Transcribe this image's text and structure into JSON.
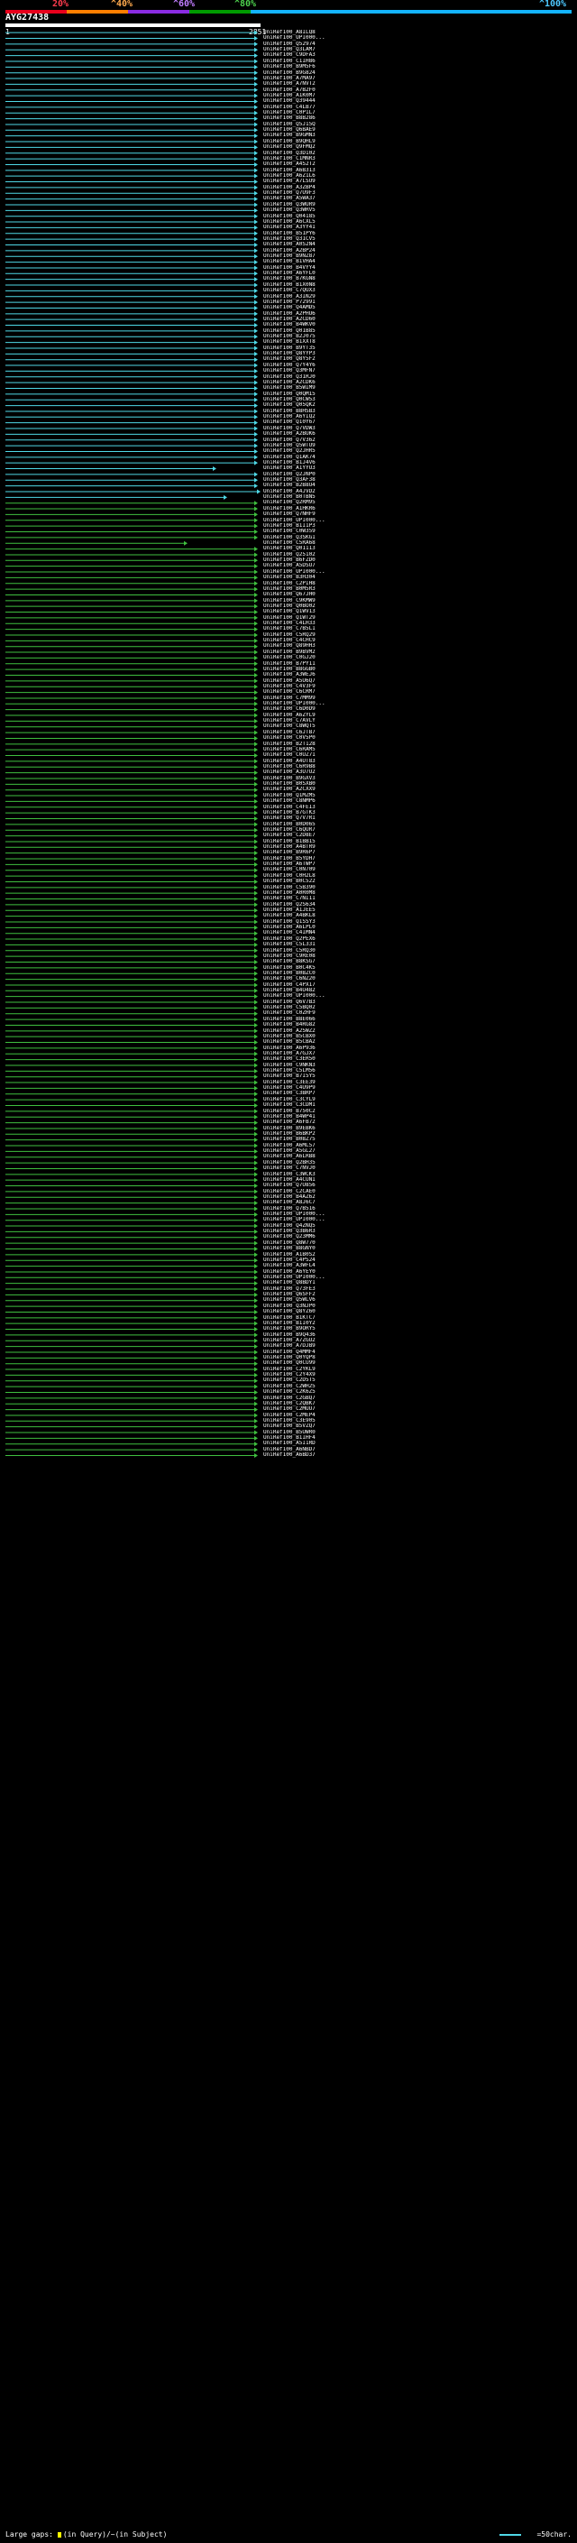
{
  "scale": {
    "labels": [
      "20%",
      "^40%",
      "^60%",
      "^80%",
      "^100%"
    ],
    "colors": [
      "#e8001c",
      "#ff7f00",
      "#8a2be2",
      "#009b00",
      "#14b4ff"
    ]
  },
  "query": {
    "id": "AYG27438",
    "start": "1",
    "end": "2851"
  },
  "hits": [
    "UniRef100_A8ILQ8",
    "UniRef100_UPI000...",
    "UniRef100_Q52974",
    "UniRef100_Q3LAM7",
    "UniRef100_C9DFA3",
    "UniRef100_C1IH86",
    "UniRef100_B9M5F6",
    "UniRef100_B9G824",
    "UniRef100_A7MA97",
    "UniRef100_A7NVT2",
    "UniRef100_A7B2F0",
    "UniRef100_A1K0M7",
    "UniRef100_Q39444",
    "UniRef100_C4LB77",
    "UniRef100_C0P1L7",
    "UniRef100_B8B286",
    "UniRef100_Q5J15Q",
    "UniRef100_Q6BAE9",
    "UniRef100_B9GMN3",
    "UniRef100_B9QHL9",
    "UniRef100_Q9FMQ2",
    "UniRef100_Q3D102",
    "UniRef100_C1MNR3",
    "UniRef100_A4S2T2",
    "UniRef100_A6B313",
    "UniRef100_A6Z1L6",
    "UniRef100_A7LSU9",
    "UniRef100_A3ZBP4",
    "UniRef100_Q7U9F3",
    "UniRef100_A5WA37",
    "UniRef100_Q3WUR9",
    "UniRef100_Q3WRV5",
    "UniRef100_Q04185",
    "UniRef100_A6CXL5",
    "UniRef100_A3YY41",
    "UniRef100_B51PY6",
    "UniRef100_Q31CV5",
    "UniRef100_A0S2N4",
    "UniRef100_A2BP24",
    "UniRef100_B9NZ87",
    "UniRef100_B1VHA4",
    "UniRef100_B4VYY4",
    "UniRef100_A6YFL0",
    "UniRef100_B7KGN8",
    "UniRef100_B1X0N8",
    "UniRef100_C7QUX3",
    "UniRef100_A3IN29",
    "UniRef100_P72991",
    "UniRef100_Q4AMD5",
    "UniRef100_A2PHU6",
    "UniRef100_A2CD60",
    "UniRef100_B4WKV0",
    "UniRef100_Q01B85",
    "UniRef100_B2J075",
    "UniRef100_B1XXT8",
    "UniRef100_B9YT35",
    "UniRef100_Q8YYP3",
    "UniRef100_Q8Y5F2",
    "UniRef100_Q7Y4Y6",
    "UniRef100_Q3MFN7",
    "UniRef100_Q31RJ0",
    "UniRef100_A2CDK6",
    "UniRef100_B5WIM9",
    "UniRef100_Q0QM15",
    "UniRef100_Q0CW53",
    "UniRef100_Q05QK2",
    "UniRef100_B8HSB3",
    "UniRef100_A6YIQ2",
    "UniRef100_Q10Y67",
    "UniRef100_Q7VDW3",
    "UniRef100_A2BUK6",
    "UniRef100_Q7V362",
    "UniRef100_Q5WTU9",
    "UniRef100_Q2JHR5",
    "UniRef100_Q1AK74",
    "UniRef100_B1J4V6",
    "UniRef100_A1YYU3",
    "UniRef100_Q2JNP0",
    "UniRef100_Q3AF38",
    "UniRef100_B2B8U4",
    "UniRef100_A4JVD2",
    "UniRef100_B0TBN5",
    "UniRef100_Q2RM95",
    "UniRef100_A1HKR6",
    "UniRef100_Q7NHF9",
    "UniRef100_UPI000...",
    "UniRef100_B1I1P3",
    "UniRef100_C0W359",
    "UniRef100_Q3SKG1",
    "UniRef100_C5RA68",
    "UniRef100_Q01113",
    "UniRef100_Q25102",
    "UniRef100_B6FZD0",
    "UniRef100_A5DSU7",
    "UniRef100_UPI000...",
    "UniRef100_B3H304",
    "UniRef100_C2PIH8",
    "UniRef100_B0M5R3",
    "UniRef100_Q67JH0",
    "UniRef100_C9KMW9",
    "UniRef100_Q0BO02",
    "UniRef100_Q1WV13",
    "UniRef100_Q1WT29",
    "UniRef100_C4LH33",
    "UniRef100_C7B5L1",
    "UniRef100_C5RQ29",
    "UniRef100_C4CHC9",
    "UniRef100_Q89HH3",
    "UniRef100_B9BVM2",
    "UniRef100_C0GJ20",
    "UniRef100_B7PY11",
    "UniRef100_B8GGB0",
    "UniRef100_A3WEJ6",
    "UniRef100_A5U6Q7",
    "UniRef100_C4V3F9",
    "UniRef100_C6CRM7",
    "UniRef100_C7MM99",
    "UniRef100_UPI000...",
    "UniRef100_C6D0D9",
    "UniRef100_A6ZYL9",
    "UniRef100_C7AVLY",
    "UniRef100_C8WQT5",
    "UniRef100_C6JTB7",
    "UniRef100_C0V5P0",
    "UniRef100_B2T128",
    "UniRef100_C6RAM5",
    "UniRef100_C0UZ71",
    "UniRef100_A4UT83",
    "UniRef100_C6R9B8",
    "UniRef100_A3U7U2",
    "UniRef100_B9GXV3",
    "UniRef100_B0SXB0",
    "UniRef100_A2CXX9",
    "UniRef100_Q1MZM5",
    "UniRef100_C8NMP6",
    "UniRef100_C4FEI3",
    "UniRef100_B7GTK3",
    "UniRef100_Q7V7R1",
    "UniRef100_B0D065",
    "UniRef100_C6QUR7",
    "UniRef100_C2D8E7",
    "UniRef100_B1BB15",
    "UniRef100_A4BTR9",
    "UniRef100_B9R6P7",
    "UniRef100_B5YDH7",
    "UniRef100_A6TWP7",
    "UniRef100_C0N709",
    "UniRef100_C0H2L8",
    "UniRef100_B0C522",
    "UniRef100_C5B390",
    "UniRef100_A0R0M8",
    "UniRef100_C7NI11",
    "UniRef100_Q2S634",
    "UniRef100_A1JEE5",
    "UniRef100_A4BKL8",
    "UniRef100_Q1SSY3",
    "UniRef100_A6LPL0",
    "UniRef100_C4IMN4",
    "UniRef100_Q2PEX6",
    "UniRef100_C5L331",
    "UniRef100_C5RQ30",
    "UniRef100_C9RE08",
    "UniRef100_B8KSG7",
    "UniRef100_B0C4K5",
    "UniRef100_B0BZC0",
    "UniRef100_C6NZ20",
    "UniRef100_C4PX17",
    "UniRef100_B4U482",
    "UniRef100_UPI000...",
    "UniRef100_Q6V7B3",
    "UniRef100_C5BQ02",
    "UniRef100_C0ZHF9",
    "UniRef100_B8E066",
    "UniRef100_B4RG82",
    "UniRef100_A2SWZ2",
    "UniRef100_B5CBX0",
    "UniRef100_B5CBA2",
    "UniRef100_A6P936",
    "UniRef100_A7GJX7",
    "UniRef100_C3ER50",
    "UniRef100_C9NKN3",
    "UniRef100_C5LM56",
    "UniRef100_B7I5Y5",
    "UniRef100_C3EE39",
    "UniRef100_C4U9P9",
    "UniRef100_C3BRP7",
    "UniRef100_C3CYL9",
    "UniRef100_C3CDM1",
    "UniRef100_B750C2",
    "UniRef100_B4WP41",
    "UniRef100_A6FB72",
    "UniRef100_B9EBK6",
    "UniRef100_B6BKP2",
    "UniRef100_B0BZ75",
    "UniRef100_A6ML57",
    "UniRef100_A5GL27",
    "UniRef100_A6LRB8",
    "UniRef100_Q2BH35",
    "UniRef100_C7NVJ0",
    "UniRef100_C3WCK3",
    "UniRef100_A4CUN1",
    "UniRef100_Q7U856",
    "UniRef100_C2CAE0",
    "UniRef100_B4AZ62",
    "UniRef100_A8J6C7",
    "UniRef100_Q7B516",
    "UniRef100_UPI000...",
    "UniRef100_UPI000...",
    "UniRef100_Q4ZNQ5",
    "UniRef100_Q3B6R3",
    "UniRef100_Q23MM6",
    "UniRef100_Q8W770",
    "UniRef100_B8GNY0",
    "UniRef100_A1B0S2",
    "UniRef100_C4PS24",
    "UniRef100_A3WFL4",
    "UniRef100_A6YEY0",
    "UniRef100_UPI000...",
    "UniRef100_Q8BDY1",
    "UniRef100_Q73FE3",
    "UniRef100_Q6SFF2",
    "UniRef100_Q5WLV6",
    "UniRef100_Q3NJP0",
    "UniRef100_Q8YZ60",
    "UniRef100_B1KTC7",
    "UniRef100_B1I0Y2",
    "UniRef100_B9ORY5",
    "UniRef100_B9Q436",
    "UniRef100_A7ZGU2",
    "UniRef100_A7DJB9",
    "UniRef100_Q4MMF4",
    "UniRef100_Q0YQP8",
    "UniRef100_Q0CU99",
    "UniRef100_C2YKL9",
    "UniRef100_C2Y4X9",
    "UniRef100_C2D5T5",
    "UniRef100_C2WH25",
    "UniRef100_C2K6Z5",
    "UniRef100_C2GBQ7",
    "UniRef100_C2QBK7",
    "UniRef100_C2MUU7",
    "UniRef100_C2MEP4",
    "UniRef100_C3E905",
    "UniRef100_B5VZQ7",
    "UniRef100_B5UWR0",
    "UniRef100_B1IHF4",
    "UniRef100_A5I1RD",
    "UniRef100_A6NBD7",
    "UniRef100_A6BD37"
  ],
  "footer": {
    "gaps_label": "Large gaps:",
    "in_query": "(in Query)/",
    "in_subject": "~(in Subject)",
    "legend": "=50char."
  }
}
